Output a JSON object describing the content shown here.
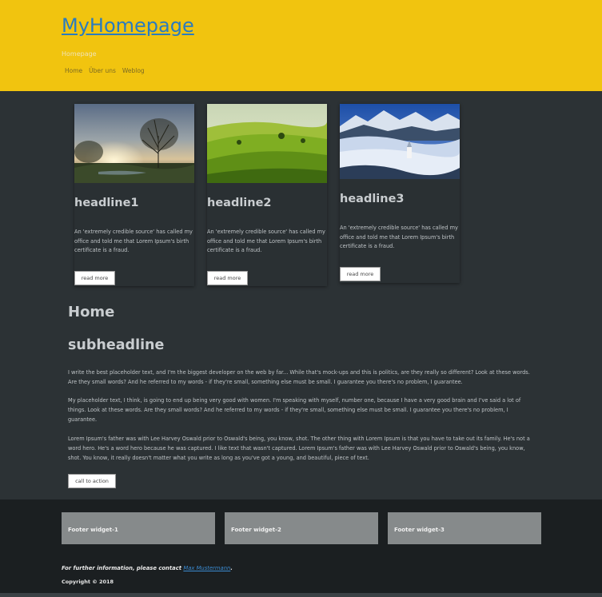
{
  "header": {
    "site_title": "MyHomepage",
    "tagline": "Homepage",
    "nav": [
      "Home",
      "Über uns",
      "Weblog"
    ]
  },
  "cards": [
    {
      "headline": "headline1",
      "text": "An 'extremely credible source' has called my office and told me that Lorem Ipsum's birth certificate is a fraud.",
      "button": "read more",
      "image": "sunset-tree-landscape-image"
    },
    {
      "headline": "headline2",
      "text": "An 'extremely credible source' has called my office and told me that Lorem Ipsum's birth certificate is a fraud.",
      "button": "read more",
      "image": "green-hills-landscape-image"
    },
    {
      "headline": "headline3",
      "text": "An 'extremely credible source' has called my office and told me that Lorem Ipsum's birth certificate is a fraud.",
      "button": "read more",
      "image": "mountain-castle-fog-image"
    }
  ],
  "main": {
    "title": "Home",
    "subheadline": "subheadline",
    "paragraphs": [
      "I write the best placeholder text, and I'm the biggest developer on the web by far... While that's mock-ups and this is politics, are they really so different? Look at these words. Are they small words? And he referred to my words - if they're small, something else must be small. I guarantee you there's no problem, I guarantee.",
      "My placeholder text, I think, is going to end up being very good with women. I'm speaking with myself, number one, because I have a very good brain and I've said a lot of things. Look at these words. Are they small words? And he referred to my words - if they're small, something else must be small. I guarantee you there's no problem, I guarantee.",
      "Lorem Ipsum's father was with Lee Harvey Oswald prior to Oswald's being, you know, shot. The other thing with Lorem Ipsum is that you have to take out its family. He's not a word hero. He's a word hero because he was captured. I like text that wasn't captured. Lorem Ipsum's father was with Lee Harvey Oswald prior to Oswald's being, you know, shot. You know, it really doesn't matter what you write as long as you've got a young, and beautiful, piece of text."
    ],
    "cta": "call to action"
  },
  "footer": {
    "widgets": [
      "Footer widget-1",
      "Footer widget-2",
      "Footer widget-3"
    ],
    "contact_prefix": "For further information, please contact ",
    "contact_name": "Max Mustermann",
    "contact_suffix": ".",
    "copyright": "Copyright © 2018"
  },
  "colors": {
    "header_bg": "#f1c40f",
    "body_bg": "#2c3235",
    "footer_bg": "#1b1f21",
    "link": "#2a7bbf",
    "widget_bg": "#868a8b"
  }
}
